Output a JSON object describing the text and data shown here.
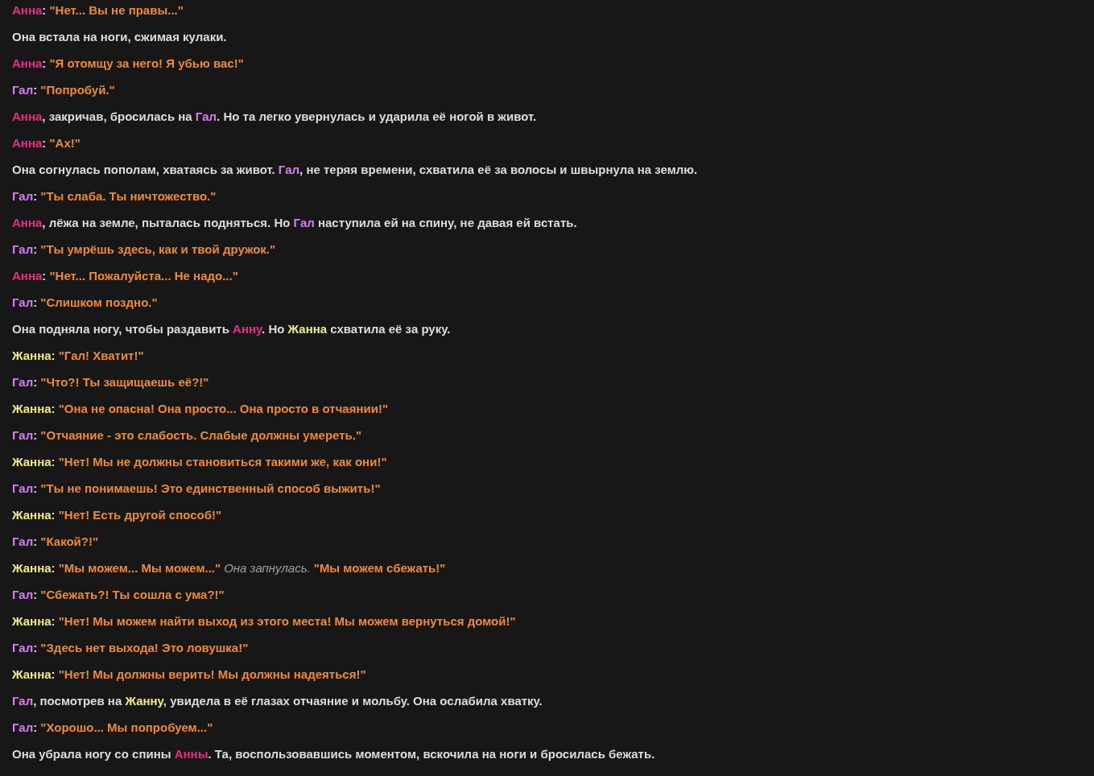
{
  "lines": [
    {
      "segments": [
        {
          "kind": "name",
          "text": "Анна",
          "color": "#f0288c"
        },
        {
          "kind": "narration",
          "text": ": "
        },
        {
          "kind": "quote",
          "text": "\"Нет... Вы не правы...\""
        }
      ]
    },
    {
      "segments": [
        {
          "kind": "narration",
          "text": "Она встала на ноги, сжимая кулаки."
        }
      ]
    },
    {
      "segments": [
        {
          "kind": "name",
          "text": "Анна",
          "color": "#f0288c"
        },
        {
          "kind": "narration",
          "text": ": "
        },
        {
          "kind": "quote",
          "text": "\"Я отомщу за него! Я убью вас!\""
        }
      ]
    },
    {
      "segments": [
        {
          "kind": "name",
          "text": "Гал",
          "color": "#d77cf5"
        },
        {
          "kind": "narration",
          "text": ": "
        },
        {
          "kind": "quote",
          "text": "\"Попробуй.\""
        }
      ]
    },
    {
      "segments": [
        {
          "kind": "name",
          "text": "Анна",
          "color": "#f0288c"
        },
        {
          "kind": "narration",
          "text": ", закричав, бросилась на "
        },
        {
          "kind": "name",
          "text": "Гал",
          "color": "#d77cf5"
        },
        {
          "kind": "narration",
          "text": ". Но та легко увернулась и ударила её ногой в живот."
        }
      ]
    },
    {
      "segments": [
        {
          "kind": "name",
          "text": "Анна",
          "color": "#f0288c"
        },
        {
          "kind": "narration",
          "text": ": "
        },
        {
          "kind": "quote",
          "text": "\"Ах!\""
        }
      ]
    },
    {
      "segments": [
        {
          "kind": "narration",
          "text": "Она согнулась пополам, хватаясь за живот. "
        },
        {
          "kind": "name",
          "text": "Гал",
          "color": "#d77cf5"
        },
        {
          "kind": "narration",
          "text": ", не теряя времени, схватила её за волосы и швырнула на землю."
        }
      ]
    },
    {
      "segments": [
        {
          "kind": "name",
          "text": "Гал",
          "color": "#d77cf5"
        },
        {
          "kind": "narration",
          "text": ": "
        },
        {
          "kind": "quote",
          "text": "\"Ты слаба. Ты ничтожество.\""
        }
      ]
    },
    {
      "segments": [
        {
          "kind": "name",
          "text": "Анна",
          "color": "#f0288c"
        },
        {
          "kind": "narration",
          "text": ", лёжа на земле, пыталась подняться. Но "
        },
        {
          "kind": "name",
          "text": "Гал",
          "color": "#d77cf5"
        },
        {
          "kind": "narration",
          "text": " наступила ей на спину, не давая ей встать."
        }
      ]
    },
    {
      "segments": [
        {
          "kind": "name",
          "text": "Гал",
          "color": "#d77cf5"
        },
        {
          "kind": "narration",
          "text": ": "
        },
        {
          "kind": "quote",
          "text": "\"Ты умрёшь здесь, как и твой дружок.\""
        }
      ]
    },
    {
      "segments": [
        {
          "kind": "name",
          "text": "Анна",
          "color": "#f0288c"
        },
        {
          "kind": "narration",
          "text": ": "
        },
        {
          "kind": "quote",
          "text": "\"Нет... Пожалуйста... Не надо...\""
        }
      ]
    },
    {
      "segments": [
        {
          "kind": "name",
          "text": "Гал",
          "color": "#d77cf5"
        },
        {
          "kind": "narration",
          "text": ": "
        },
        {
          "kind": "quote",
          "text": "\"Слишком поздно.\""
        }
      ]
    },
    {
      "segments": [
        {
          "kind": "narration",
          "text": "Она подняла ногу, чтобы раздавить "
        },
        {
          "kind": "name",
          "text": "Анну",
          "color": "#f0288c"
        },
        {
          "kind": "narration",
          "text": ". Но "
        },
        {
          "kind": "name",
          "text": "Жанна",
          "color": "#f1ec8a"
        },
        {
          "kind": "narration",
          "text": " схватила её за руку."
        }
      ]
    },
    {
      "segments": [
        {
          "kind": "name",
          "text": "Жанна",
          "color": "#f1ec8a"
        },
        {
          "kind": "narration",
          "text": ": "
        },
        {
          "kind": "quote",
          "text": "\"Гал! Хватит!\""
        }
      ]
    },
    {
      "segments": [
        {
          "kind": "name",
          "text": "Гал",
          "color": "#d77cf5"
        },
        {
          "kind": "narration",
          "text": ": "
        },
        {
          "kind": "quote",
          "text": "\"Что?! Ты защищаешь её?!\""
        }
      ]
    },
    {
      "segments": [
        {
          "kind": "name",
          "text": "Жанна",
          "color": "#f1ec8a"
        },
        {
          "kind": "narration",
          "text": ": "
        },
        {
          "kind": "quote",
          "text": "\"Она не опасна! Она просто... Она просто в отчаянии!\""
        }
      ]
    },
    {
      "segments": [
        {
          "kind": "name",
          "text": "Гал",
          "color": "#d77cf5"
        },
        {
          "kind": "narration",
          "text": ": "
        },
        {
          "kind": "quote",
          "text": "\"Отчаяние - это слабость. Слабые должны умереть.\""
        }
      ]
    },
    {
      "segments": [
        {
          "kind": "name",
          "text": "Жанна",
          "color": "#f1ec8a"
        },
        {
          "kind": "narration",
          "text": ": "
        },
        {
          "kind": "quote",
          "text": "\"Нет! Мы не должны становиться такими же, как они!\""
        }
      ]
    },
    {
      "segments": [
        {
          "kind": "name",
          "text": "Гал",
          "color": "#d77cf5"
        },
        {
          "kind": "narration",
          "text": ": "
        },
        {
          "kind": "quote",
          "text": "\"Ты не понимаешь! Это единственный способ выжить!\""
        }
      ]
    },
    {
      "segments": [
        {
          "kind": "name",
          "text": "Жанна",
          "color": "#f1ec8a"
        },
        {
          "kind": "narration",
          "text": ": "
        },
        {
          "kind": "quote",
          "text": "\"Нет! Есть другой способ!\""
        }
      ]
    },
    {
      "segments": [
        {
          "kind": "name",
          "text": "Гал",
          "color": "#d77cf5"
        },
        {
          "kind": "narration",
          "text": ": "
        },
        {
          "kind": "quote",
          "text": "\"Какой?!\""
        }
      ]
    },
    {
      "segments": [
        {
          "kind": "name",
          "text": "Жанна",
          "color": "#f1ec8a"
        },
        {
          "kind": "narration",
          "text": ": "
        },
        {
          "kind": "quote",
          "text": "\"Мы можем... Мы можем...\""
        },
        {
          "kind": "italic",
          "text": "Она запнулась."
        },
        {
          "kind": "quote",
          "text": "\"Мы можем сбежать!\""
        }
      ]
    },
    {
      "segments": [
        {
          "kind": "name",
          "text": "Гал",
          "color": "#d77cf5"
        },
        {
          "kind": "narration",
          "text": ": "
        },
        {
          "kind": "quote",
          "text": "\"Сбежать?! Ты сошла с ума?!\""
        }
      ]
    },
    {
      "segments": [
        {
          "kind": "name",
          "text": "Жанна",
          "color": "#f1ec8a"
        },
        {
          "kind": "narration",
          "text": ": "
        },
        {
          "kind": "quote",
          "text": "\"Нет! Мы можем найти выход из этого места! Мы можем вернуться домой!\""
        }
      ]
    },
    {
      "segments": [
        {
          "kind": "name",
          "text": "Гал",
          "color": "#d77cf5"
        },
        {
          "kind": "narration",
          "text": ": "
        },
        {
          "kind": "quote",
          "text": "\"Здесь нет выхода! Это ловушка!\""
        }
      ]
    },
    {
      "segments": [
        {
          "kind": "name",
          "text": "Жанна",
          "color": "#f1ec8a"
        },
        {
          "kind": "narration",
          "text": ": "
        },
        {
          "kind": "quote",
          "text": "\"Нет! Мы должны верить! Мы должны надеяться!\""
        }
      ]
    },
    {
      "segments": [
        {
          "kind": "name",
          "text": "Гал",
          "color": "#d77cf5"
        },
        {
          "kind": "narration",
          "text": ", посмотрев на "
        },
        {
          "kind": "name",
          "text": "Жанну",
          "color": "#f1ec8a"
        },
        {
          "kind": "narration",
          "text": ", увидела в её глазах отчаяние и мольбу. Она ослабила хватку."
        }
      ]
    },
    {
      "segments": [
        {
          "kind": "name",
          "text": "Гал",
          "color": "#d77cf5"
        },
        {
          "kind": "narration",
          "text": ": "
        },
        {
          "kind": "quote",
          "text": "\"Хорошо... Мы попробуем...\""
        }
      ]
    },
    {
      "segments": [
        {
          "kind": "narration",
          "text": "Она убрала ногу со спины "
        },
        {
          "kind": "name",
          "text": "Анны",
          "color": "#f0288c"
        },
        {
          "kind": "narration",
          "text": ". Та, воспользовавшись моментом, вскочила на ноги и бросилась бежать."
        }
      ]
    }
  ]
}
